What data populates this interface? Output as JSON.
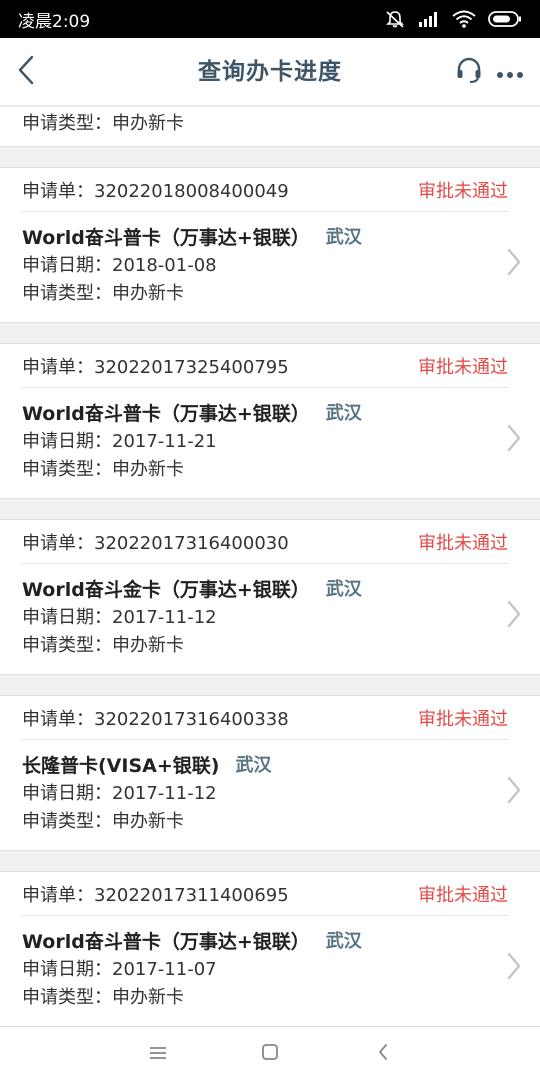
{
  "status_bar": {
    "time": "凌晨2:09",
    "icons": [
      "mute-icon",
      "signal-icon",
      "wifi-icon",
      "battery-icon"
    ]
  },
  "header": {
    "title": "查询办卡进度",
    "back_icon": "back-arrow-icon",
    "support_icon": "headset-icon",
    "more_icon": "more-dots-icon"
  },
  "colors": {
    "title": "#3d5566",
    "status_rejected": "#e24b4b",
    "city": "#5a7585"
  },
  "partial_top": {
    "type_label": "申请类型：申办新卡"
  },
  "applications": [
    {
      "order": "申请单：32022018008400049",
      "status": "审批未通过",
      "card_name": "World奋斗普卡（万事达+银联）",
      "city": "武汉",
      "date": "申请日期：2018-01-08",
      "type": "申请类型：申办新卡"
    },
    {
      "order": "申请单：32022017325400795",
      "status": "审批未通过",
      "card_name": "World奋斗普卡（万事达+银联）",
      "city": "武汉",
      "date": "申请日期：2017-11-21",
      "type": "申请类型：申办新卡"
    },
    {
      "order": "申请单：32022017316400030",
      "status": "审批未通过",
      "card_name": "World奋斗金卡（万事达+银联）",
      "city": "武汉",
      "date": "申请日期：2017-11-12",
      "type": "申请类型：申办新卡"
    },
    {
      "order": "申请单：32022017316400338",
      "status": "审批未通过",
      "card_name": "长隆普卡(VISA+银联)",
      "city": "武汉",
      "date": "申请日期：2017-11-12",
      "type": "申请类型：申办新卡"
    },
    {
      "order": "申请单：32022017311400695",
      "status": "审批未通过",
      "card_name": "World奋斗普卡（万事达+银联）",
      "city": "武汉",
      "date": "申请日期：2017-11-07",
      "type": "申请类型：申办新卡"
    }
  ],
  "nav_bar": {
    "icons": [
      "menu-icon",
      "home-icon",
      "back-icon"
    ]
  }
}
